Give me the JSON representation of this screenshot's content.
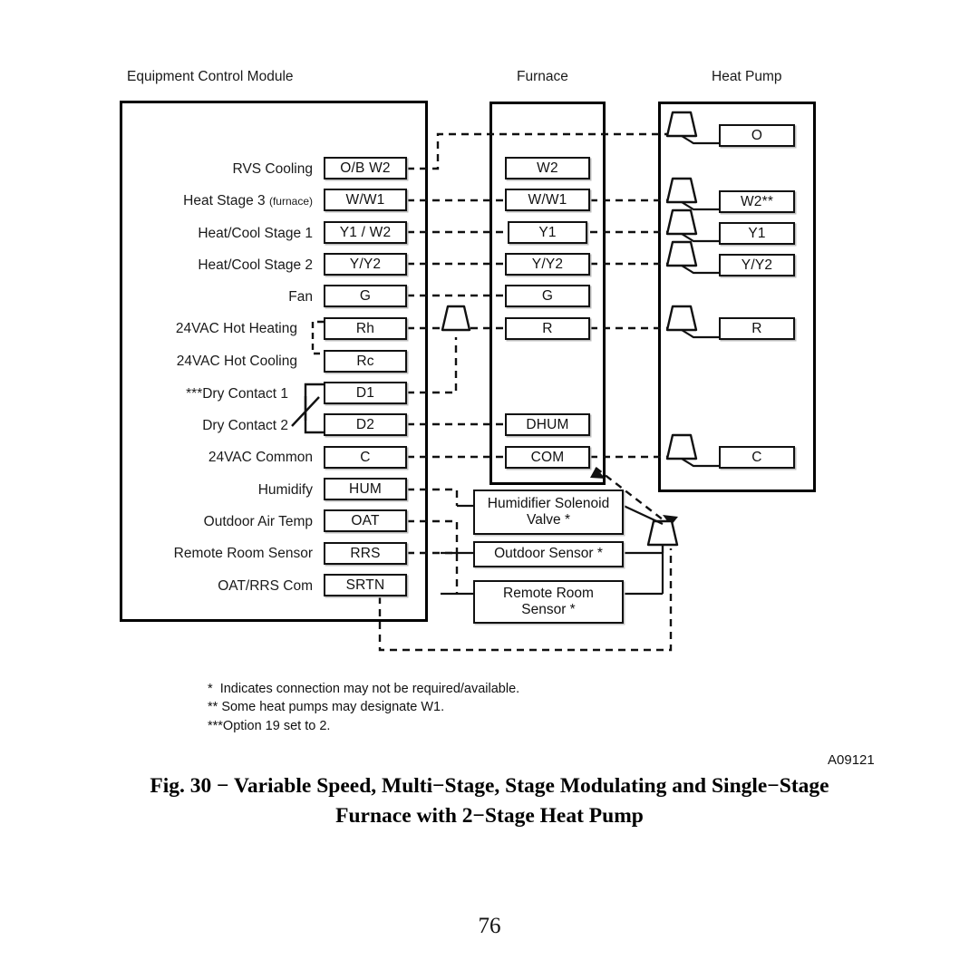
{
  "figure": {
    "columns": [
      {
        "id": "ecm",
        "title": "Equipment Control Module"
      },
      {
        "id": "furnace",
        "title": "Furnace"
      },
      {
        "id": "heatpump",
        "title": "Heat Pump"
      }
    ],
    "ecm_rows": [
      {
        "label": "RVS Cooling",
        "sublabel": "",
        "terminal": "O/B W2"
      },
      {
        "label": "Heat Stage 3",
        "sublabel": "(furnace)",
        "terminal": "W/W1"
      },
      {
        "label": "Heat/Cool Stage 1",
        "sublabel": "",
        "terminal": "Y1 / W2"
      },
      {
        "label": "Heat/Cool Stage 2",
        "sublabel": "",
        "terminal": "Y/Y2"
      },
      {
        "label": "Fan",
        "sublabel": "",
        "terminal": "G"
      },
      {
        "label": "24VAC Hot Heating",
        "sublabel": "",
        "terminal": "Rh"
      },
      {
        "label": "24VAC Hot Cooling",
        "sublabel": "",
        "terminal": "Rc"
      },
      {
        "label": "***Dry Contact 1",
        "sublabel": "",
        "terminal": "D1"
      },
      {
        "label": "Dry Contact 2",
        "sublabel": "",
        "terminal": "D2"
      },
      {
        "label": "24VAC Common",
        "sublabel": "",
        "terminal": "C"
      },
      {
        "label": "Humidify",
        "sublabel": "",
        "terminal": "HUM"
      },
      {
        "label": "Outdoor Air Temp",
        "sublabel": "",
        "terminal": "OAT"
      },
      {
        "label": "Remote Room Sensor",
        "sublabel": "",
        "terminal": "RRS"
      },
      {
        "label": "OAT/RRS Com",
        "sublabel": "",
        "terminal": "SRTN"
      }
    ],
    "furnace_terminals": [
      "W2",
      "W/W1",
      "Y1",
      "Y/Y2",
      "G",
      "R",
      "DHUM",
      "COM"
    ],
    "heatpump_terminals": [
      "O",
      "W2**",
      "Y1",
      "Y/Y2",
      "R",
      "C"
    ],
    "accessories": [
      {
        "line1": "Humidifier Solenoid",
        "line2": "Valve  *"
      },
      {
        "line1": "Outdoor Sensor *",
        "line2": ""
      },
      {
        "line1": "Remote Room",
        "line2": "Sensor *"
      }
    ],
    "notes": [
      "*  Indicates connection may not be required/available.",
      "** Some heat pumps may designate W1.",
      "***Option 19 set to 2."
    ],
    "figure_code": "A09121",
    "caption_line1": "Fig. 30 −  Variable Speed, Multi−Stage, Stage Modulating and Single−Stage",
    "caption_line2": "Furnace with 2−Stage Heat Pump",
    "page_number": "76",
    "colors": {
      "ink": "#000000",
      "line": "#111111",
      "paper": "#ffffff"
    }
  }
}
